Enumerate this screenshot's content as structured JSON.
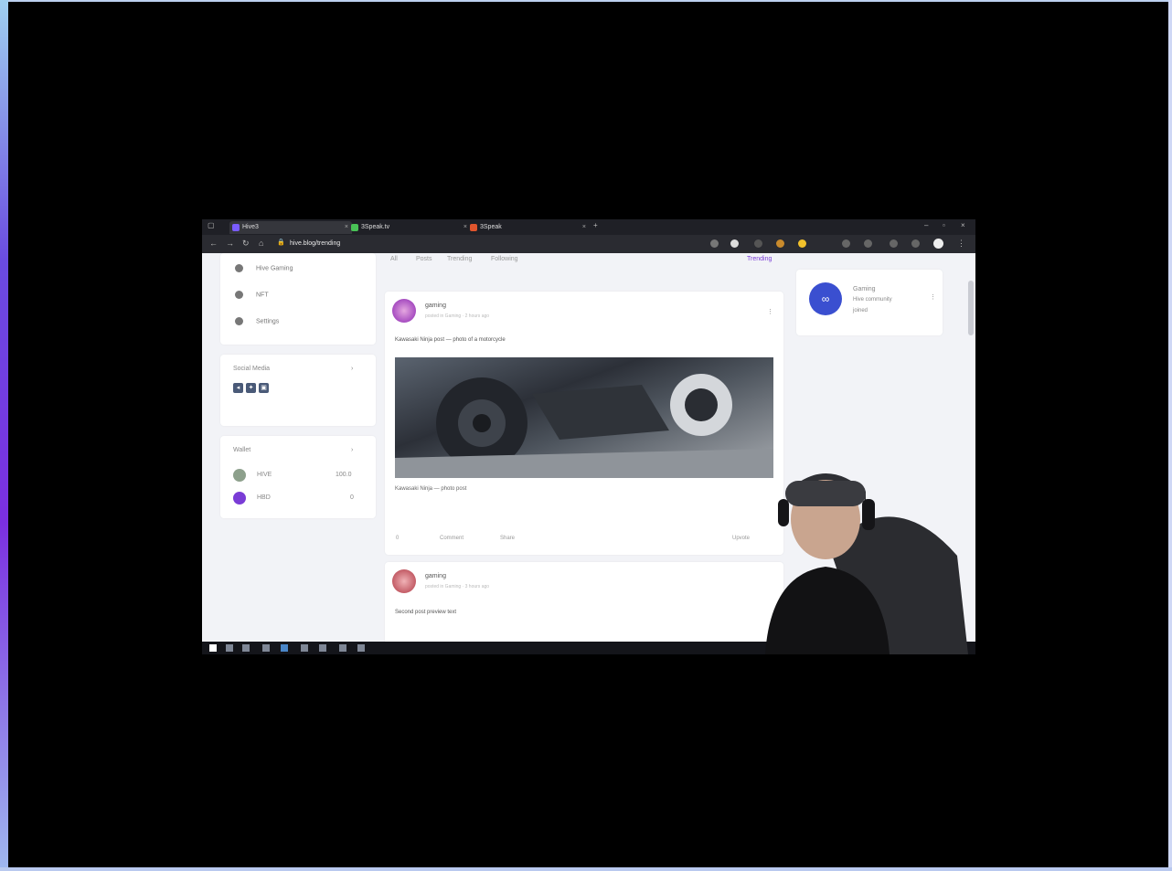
{
  "browser": {
    "tabs": [
      {
        "label": "Hive3"
      },
      {
        "label": "3Speak.tv"
      },
      {
        "label": "3Speak"
      }
    ],
    "url": "hive.blog/trending"
  },
  "sidebar": {
    "menu": [
      {
        "label": "Hive Gaming",
        "icon": "hive-icon"
      },
      {
        "label": "NFT",
        "icon": "nft-icon"
      },
      {
        "label": "Settings",
        "icon": "gear-icon"
      }
    ],
    "social_title": "Social Media",
    "social_icons": [
      "share-icon",
      "twitter-icon",
      "copy-icon"
    ],
    "wallet_title": "Wallet",
    "wallet_items": [
      {
        "label": "HIVE",
        "value": "100.0"
      },
      {
        "label": "HBD",
        "value": "0"
      }
    ]
  },
  "filters": {
    "tabs": [
      "All",
      "Posts",
      "Trending",
      "Following"
    ],
    "sort_label": "Trending"
  },
  "posts": [
    {
      "author": "gaming",
      "meta": "posted in Gaming · 2 hours ago",
      "text": "Kawasaki Ninja post — photo of a motorcycle",
      "link_title": "Kawasaki Ninja — photo post",
      "actions": [
        "0",
        "Comment",
        "Share",
        "Upvote"
      ]
    },
    {
      "author": "gaming",
      "meta": "posted in Gaming · 3 hours ago",
      "text": "Second post preview text",
      "actions": []
    }
  ],
  "right_panel": {
    "title": "Gaming",
    "subtitle": "Hive community",
    "stat": "joined"
  },
  "colors": {
    "accent": "#7a3cd6",
    "chrome": "#1f2026",
    "page_bg": "#f2f3f7"
  }
}
